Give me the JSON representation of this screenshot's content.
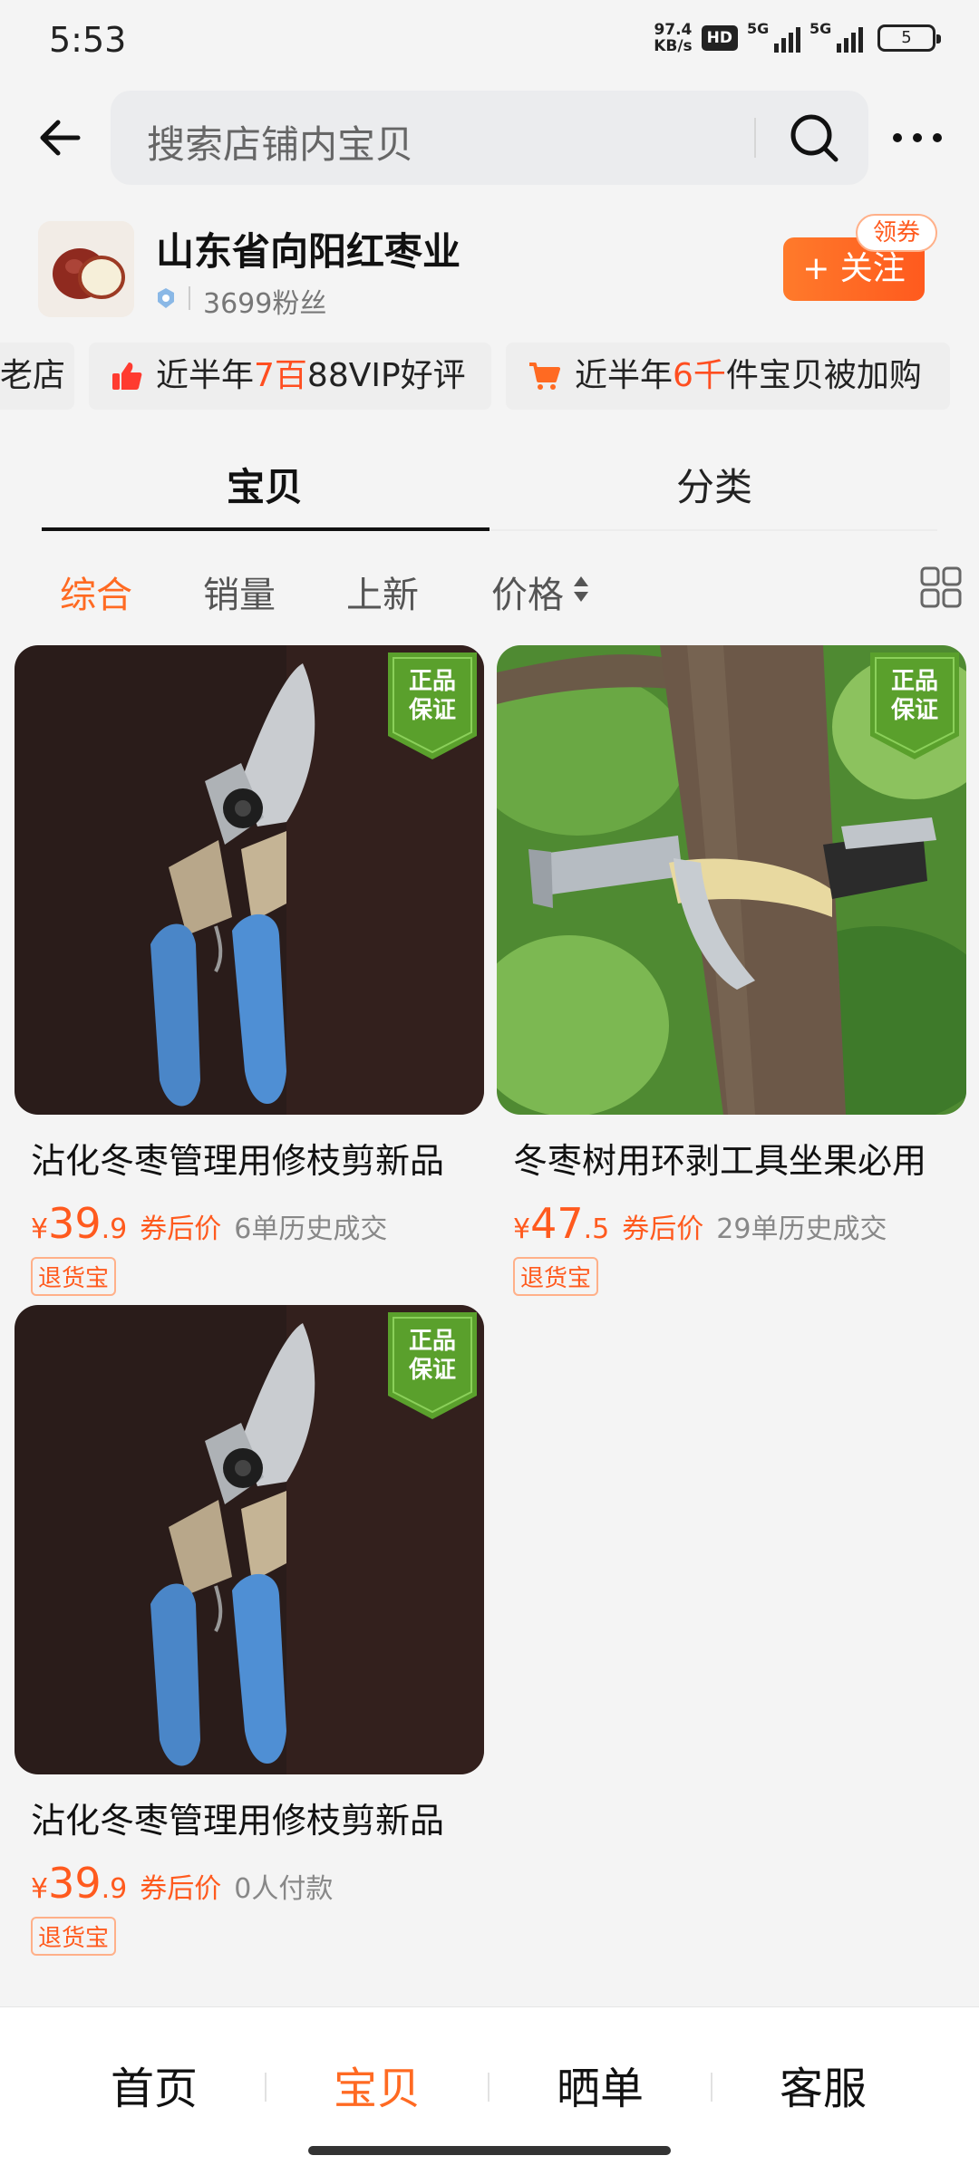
{
  "status_bar": {
    "time": "5:53",
    "net_speed_value": "97.4",
    "net_speed_unit": "KB/s",
    "hd_label": "HD",
    "sim1_label": "5G",
    "sim2_label": "5G",
    "battery": "5"
  },
  "header": {
    "search_placeholder": "搜索店铺内宝贝"
  },
  "shop": {
    "name": "山东省向阳红枣业",
    "fans": "3699粉丝",
    "follow_label": "+ 关注",
    "coupon_label": "领券"
  },
  "highlights": [
    {
      "prefix": "老店",
      "highlight": "",
      "suffix": ""
    },
    {
      "prefix": "近半年",
      "highlight": "7百",
      "suffix": "88VIP好评"
    },
    {
      "prefix": "近半年",
      "highlight": "6千",
      "suffix": "件宝贝被加购"
    }
  ],
  "tabs": [
    "宝贝",
    "分类"
  ],
  "sort": [
    "综合",
    "销量",
    "上新",
    "价格"
  ],
  "products": [
    {
      "title": "沾化冬枣管理用修枝剪新品",
      "price_symbol": "¥",
      "price_int": "39",
      "price_dec": ".9",
      "price_note": "券后价",
      "sales": "6单历史成交",
      "tag": "退货宝",
      "badge_line1": "正品",
      "badge_line2": "保证"
    },
    {
      "title": "冬枣树用环剥工具坐果必用",
      "price_symbol": "¥",
      "price_int": "47",
      "price_dec": ".5",
      "price_note": "券后价",
      "sales": "29单历史成交",
      "tag": "退货宝",
      "badge_line1": "正品",
      "badge_line2": "保证"
    },
    {
      "title": "沾化冬枣管理用修枝剪新品",
      "price_symbol": "¥",
      "price_int": "39",
      "price_dec": ".9",
      "price_note": "券后价",
      "sales": "0人付款",
      "tag": "退货宝",
      "badge_line1": "正品",
      "badge_line2": "保证"
    }
  ],
  "bottom_nav": [
    "首页",
    "宝贝",
    "晒单",
    "客服"
  ],
  "colors": {
    "accent": "#ff6a22",
    "price": "#ff5a1e",
    "badge_green": "#5aa02c"
  }
}
